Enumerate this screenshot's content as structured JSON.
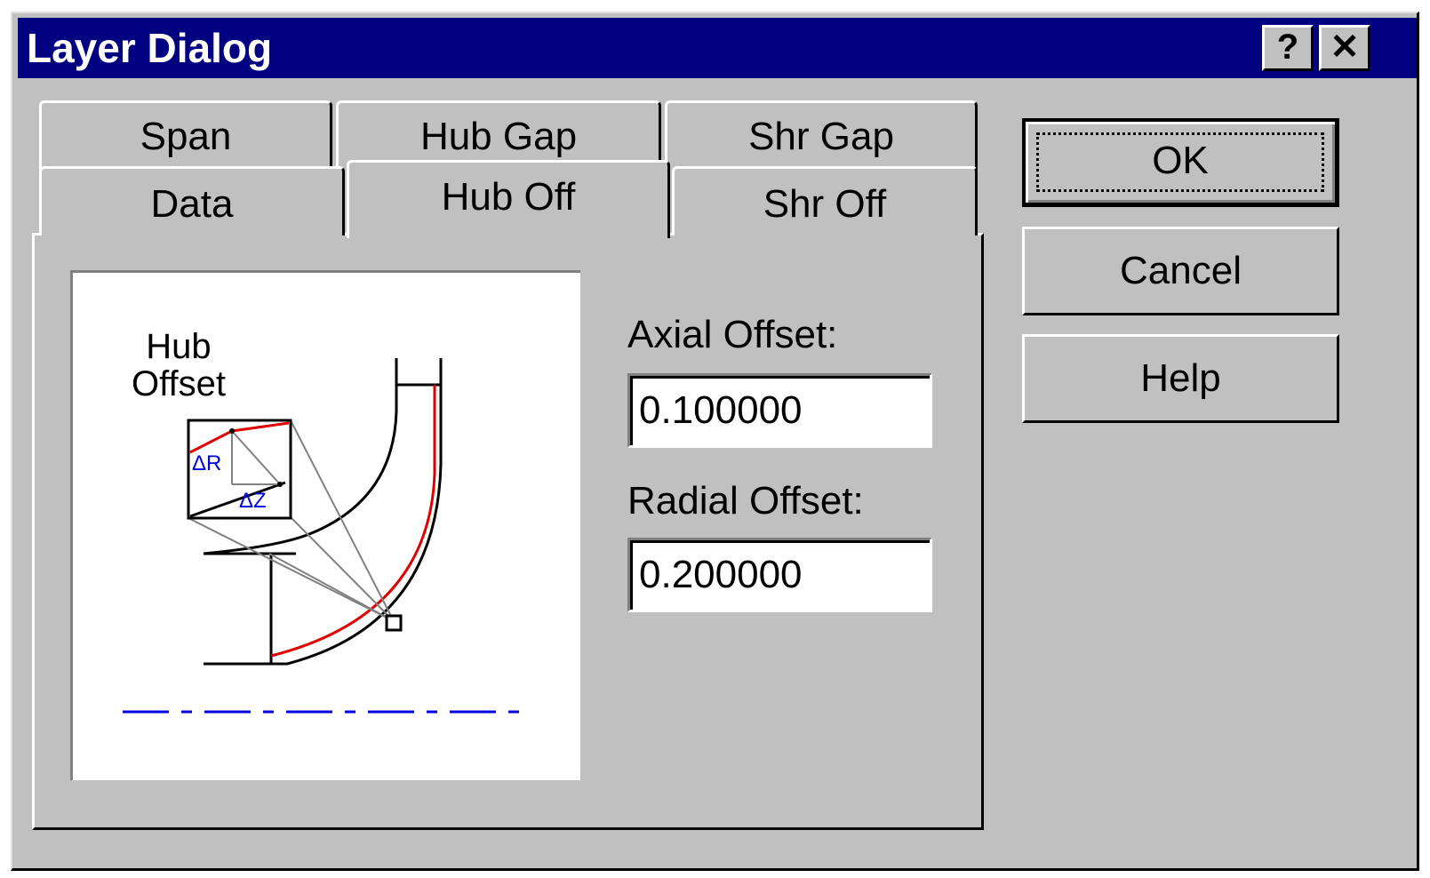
{
  "window": {
    "title": "Layer Dialog",
    "help_label": "?",
    "close_label": "✕"
  },
  "tabs": {
    "row1": [
      "Span",
      "Hub Gap",
      "Shr Gap"
    ],
    "row2": [
      "Data",
      "Hub Off",
      "Shr Off"
    ],
    "selected": "Hub Off"
  },
  "diagram": {
    "title_line1": "Hub",
    "title_line2": "Offset",
    "delta_r": "ΔR",
    "delta_z": "ΔZ",
    "colors": {
      "curve": "#000000",
      "offset": "#e00000",
      "guide": "#808080",
      "axis": "#0000e0"
    }
  },
  "axial_offset": {
    "label": "Axial Offset:",
    "value": "0.100000"
  },
  "radial_offset": {
    "label": "Radial Offset:",
    "value": "0.200000"
  },
  "buttons": {
    "ok": "OK",
    "cancel": "Cancel",
    "help": "Help"
  }
}
